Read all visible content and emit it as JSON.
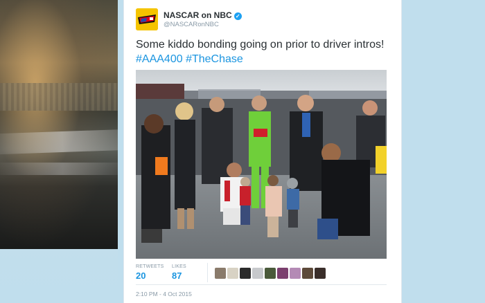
{
  "tweet": {
    "display_name": "NASCAR on NBC",
    "handle": "@NASCARonNBC",
    "text_prefix": "Some kiddo bonding going on prior to driver intros! ",
    "hashtags": [
      "#AAA400",
      "#TheChase"
    ],
    "timestamp": "2:10 PM - 4 Oct 2015"
  },
  "stats": {
    "retweets_label": "RETWEETS",
    "retweets_value": "20",
    "likes_label": "LIKES",
    "likes_value": "87"
  },
  "likers": [
    {
      "color": "#8a7b6b"
    },
    {
      "color": "#d8d2c4"
    },
    {
      "color": "#2b2b2b"
    },
    {
      "color": "#c7c9cc"
    },
    {
      "color": "#4a5a3a"
    },
    {
      "color": "#7b3f6e"
    },
    {
      "color": "#b48ab5"
    },
    {
      "color": "#5d4a3a"
    },
    {
      "color": "#3a2e2a"
    }
  ],
  "colors": {
    "accent": "#1b95e0",
    "page_bg": "#c0deed",
    "avatar_bg": "#f5c400",
    "verified": "#1da1f2"
  },
  "icons": {
    "verified": "verified-badge-icon",
    "caret": "chevron-down-icon"
  }
}
